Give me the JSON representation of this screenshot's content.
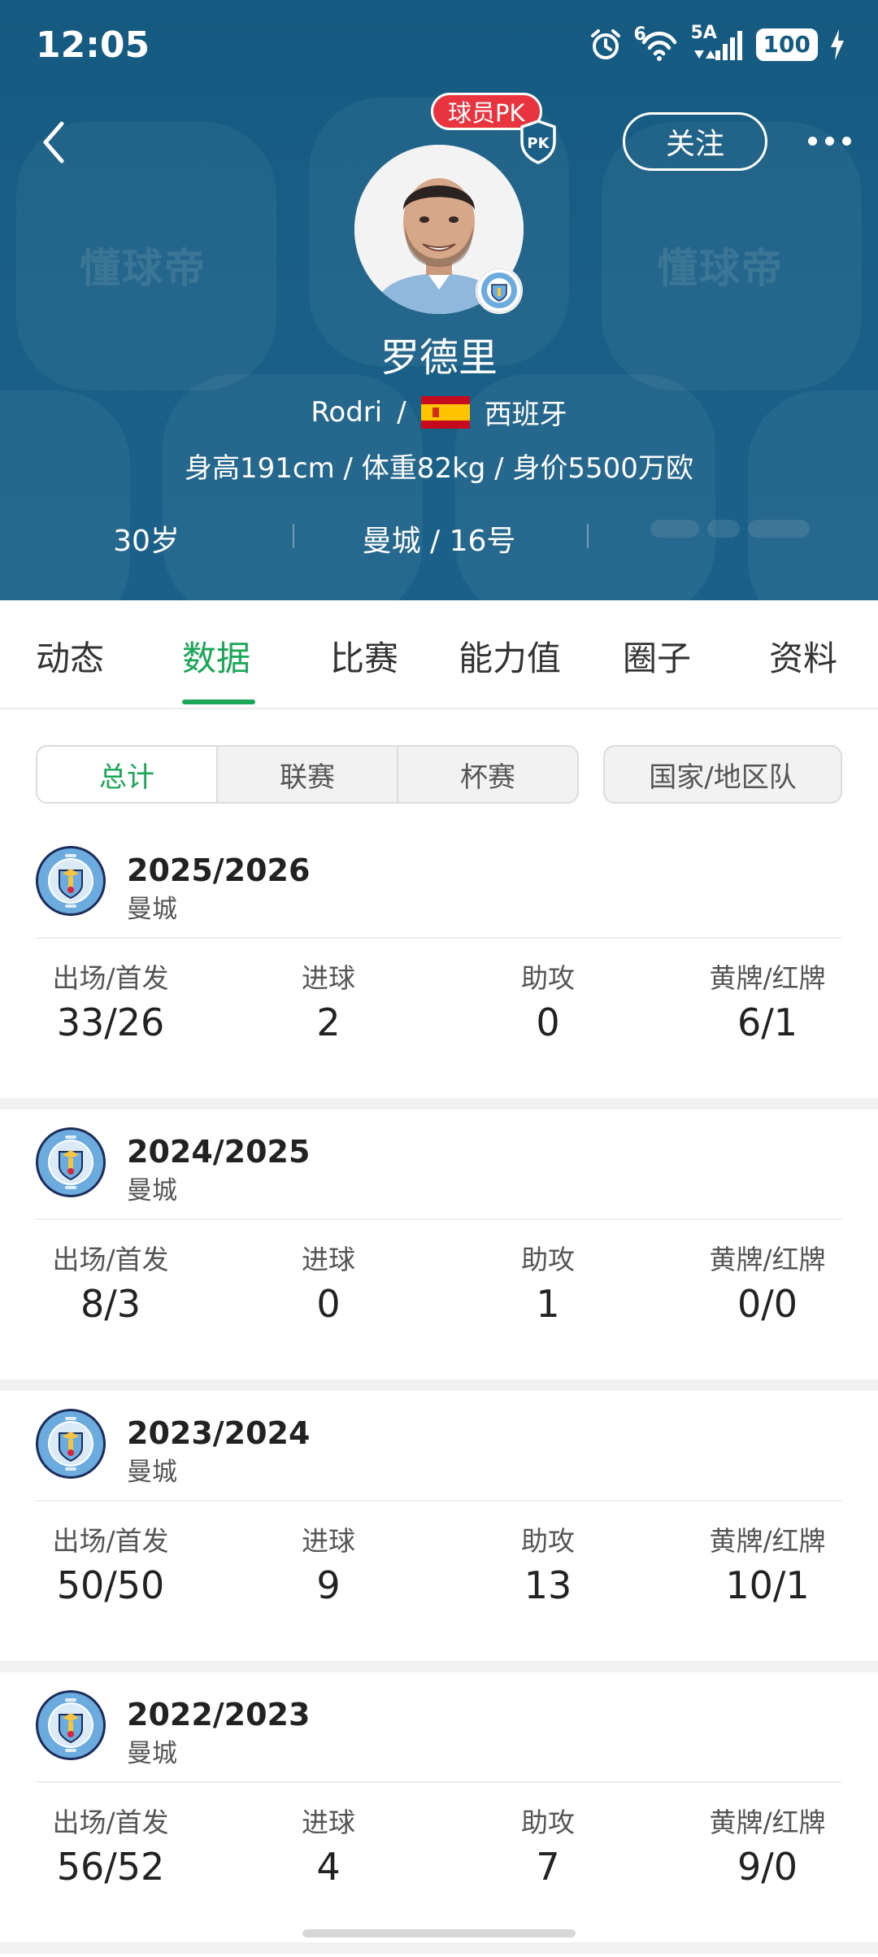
{
  "status": {
    "time": "12:05",
    "battery": "100",
    "network": "5A",
    "wifi_badge": "6",
    "icons": [
      "alarm-icon",
      "wifi-icon",
      "signal-icon",
      "battery-icon",
      "charging-icon"
    ]
  },
  "header": {
    "pk_label": "球员PK",
    "follow_label": "关注",
    "watermark": "懂球帝",
    "player_name": "罗德里",
    "english_name": "Rodri",
    "slash": "/",
    "nationality": "西班牙",
    "body_info": "身高191cm / 体重82kg / 身价5500万欧",
    "age": "30岁",
    "club_number": "曼城 / 16号"
  },
  "tabs": [
    "动态",
    "数据",
    "比赛",
    "能力值",
    "圈子",
    "资料"
  ],
  "active_tab": "数据",
  "segments": [
    "总计",
    "联赛",
    "杯赛"
  ],
  "national_label": "国家/地区队",
  "stat_labels": {
    "apps": "出场/首发",
    "goals": "进球",
    "assists": "助攻",
    "cards": "黄牌/红牌"
  },
  "seasons": [
    {
      "year": "2025/2026",
      "team": "曼城",
      "apps": "33/26",
      "goals": "2",
      "assists": "0",
      "cards": "6/1"
    },
    {
      "year": "2024/2025",
      "team": "曼城",
      "apps": "8/3",
      "goals": "0",
      "assists": "1",
      "cards": "0/0"
    },
    {
      "year": "2023/2024",
      "team": "曼城",
      "apps": "50/50",
      "goals": "9",
      "assists": "13",
      "cards": "10/1"
    },
    {
      "year": "2022/2023",
      "team": "曼城",
      "apps": "56/52",
      "goals": "4",
      "assists": "7",
      "cards": "9/0"
    }
  ],
  "colors": {
    "header_bg": "#1a5f86",
    "accent_green": "#1aa656",
    "pk_red": "#e8343f",
    "city_blue": "#6cabdd"
  }
}
